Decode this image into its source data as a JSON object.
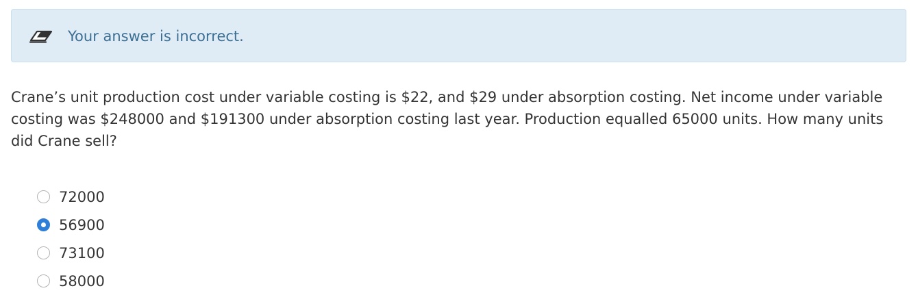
{
  "feedback": {
    "icon": "eraser-icon",
    "message": "Your answer is incorrect.",
    "background_color": "#dfecf6",
    "text_color": "#3d6f93"
  },
  "question": {
    "text": "Crane’s unit production cost under variable costing is $22, and $29 under absorption costing. Net income under variable costing was $248000 and $191300 under absorption costing last year. Production equalled 65000 units. How many units did Crane sell?"
  },
  "options": [
    {
      "label": "72000",
      "selected": false
    },
    {
      "label": "56900",
      "selected": true
    },
    {
      "label": "73100",
      "selected": false
    },
    {
      "label": "58000",
      "selected": false
    }
  ],
  "colors": {
    "radio_selected": "#2f7fd8"
  }
}
